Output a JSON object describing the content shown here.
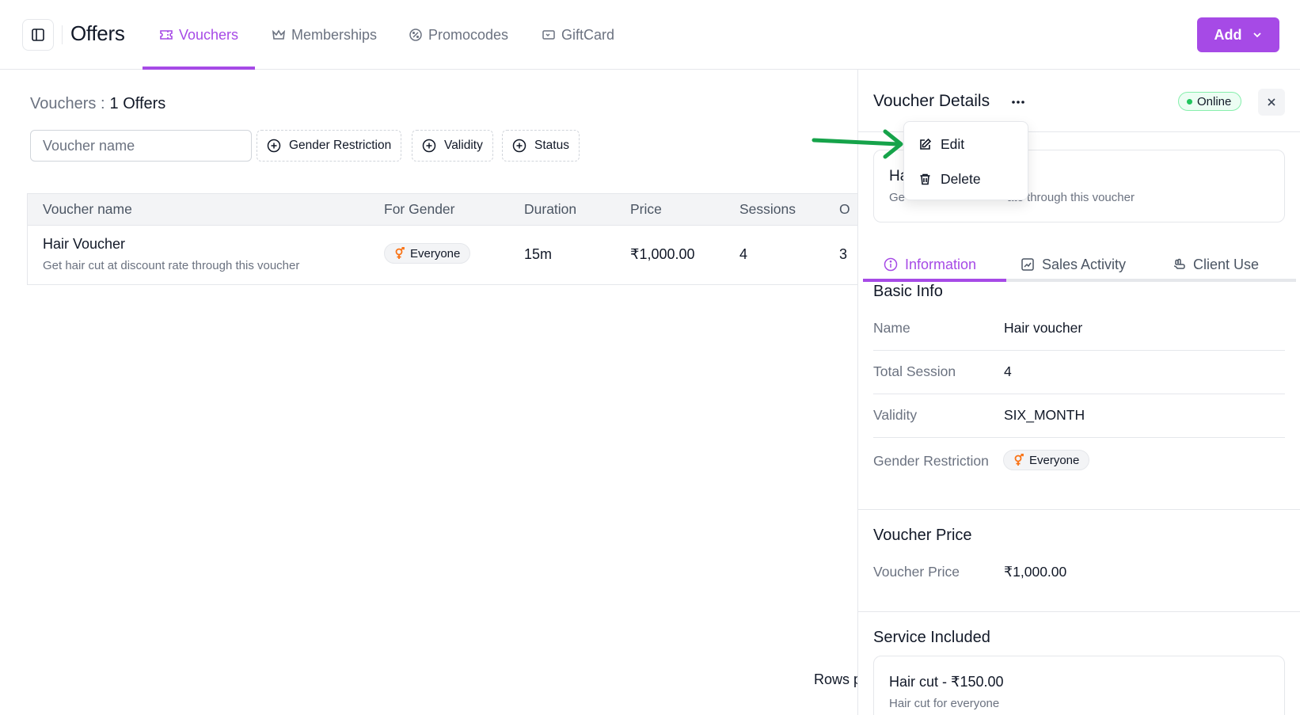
{
  "header": {
    "title": "Offers",
    "tabs": [
      {
        "label": "Vouchers",
        "icon": "ticket-icon"
      },
      {
        "label": "Memberships",
        "icon": "crown-icon"
      },
      {
        "label": "Promocodes",
        "icon": "badge-percent-icon"
      },
      {
        "label": "GiftCard",
        "icon": "gift-card-icon"
      }
    ],
    "active_tab": "Vouchers",
    "add_label": "Add"
  },
  "main": {
    "subtitle_label": "Vouchers :",
    "subtitle_count": "1 Offers",
    "search": {
      "placeholder": "Voucher name",
      "value": ""
    },
    "filters": [
      "Gender Restriction",
      "Validity",
      "Status"
    ],
    "table": {
      "columns": [
        "Voucher name",
        "For Gender",
        "Duration",
        "Price",
        "Sessions",
        "O"
      ],
      "rows": [
        {
          "name": "Hair Voucher",
          "description": "Get hair cut at discount rate through this voucher",
          "gender": "Everyone",
          "duration": "15m",
          "price": "₹1,000.00",
          "sessions": "4",
          "other": "3"
        }
      ]
    },
    "rows_per_page_label": "Rows p"
  },
  "panel": {
    "title": "Voucher Details",
    "status": "Online",
    "summary": {
      "name_prefix": "Ha",
      "desc_prefix": "Ge",
      "desc_suffix": "ate through this voucher"
    },
    "menu": {
      "items": [
        "Edit",
        "Delete"
      ]
    },
    "tabs": [
      "Information",
      "Sales Activity",
      "Client Use"
    ],
    "active_tab": "Information",
    "basic_info": {
      "title": "Basic Info",
      "rows": [
        {
          "label": "Name",
          "value": "Hair voucher"
        },
        {
          "label": "Total Session",
          "value": "4"
        },
        {
          "label": "Validity",
          "value": "SIX_MONTH"
        },
        {
          "label": "Gender Restriction",
          "value": "Everyone"
        }
      ]
    },
    "voucher_price": {
      "title": "Voucher Price",
      "label": "Voucher Price",
      "value": "₹1,000.00"
    },
    "service_included": {
      "title": "Service Included",
      "items": [
        {
          "name": "Hair cut - ₹150.00",
          "description": "Hair cut for everyone"
        }
      ]
    }
  },
  "colors": {
    "accent": "#a64ae6",
    "online_green": "#22c55e",
    "gender_orange": "#f97316",
    "arrow_green": "#16a34a"
  }
}
